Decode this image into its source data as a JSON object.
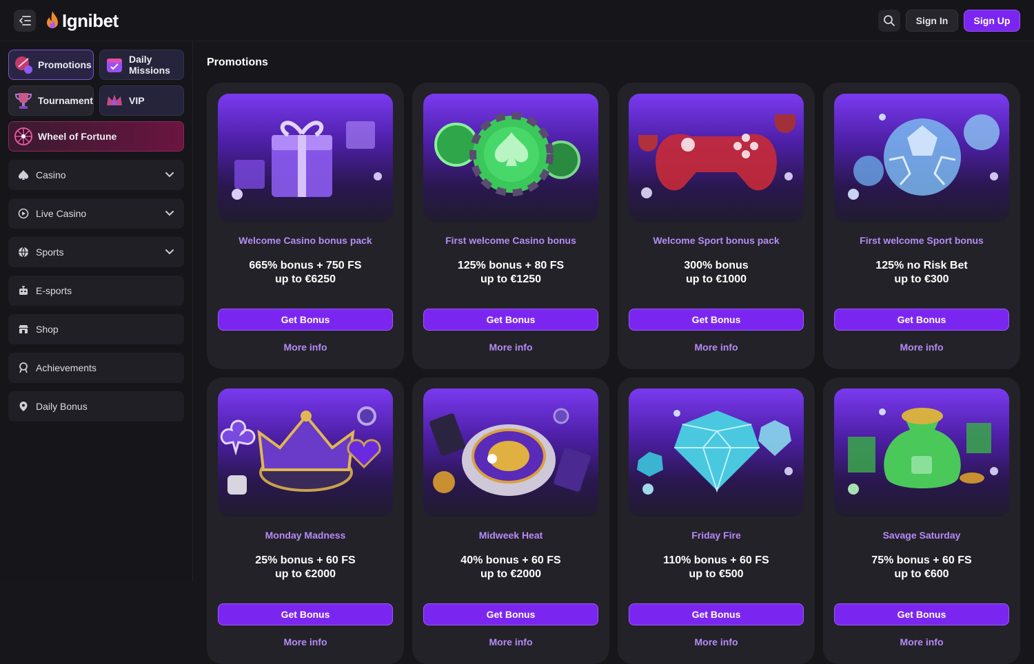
{
  "header": {
    "logo_text": "Ignibet",
    "sign_in": "Sign In",
    "sign_up": "Sign Up"
  },
  "sidebar": {
    "quick": {
      "promotions": "Promotions",
      "daily_line1": "Daily",
      "daily_line2": "Missions",
      "tournament": "Tournament",
      "vip": "VIP",
      "wheel": "Wheel of Fortune"
    },
    "nav": {
      "casino": "Casino",
      "live_casino": "Live Casino",
      "sports": "Sports",
      "esports": "E-sports",
      "shop": "Shop",
      "achievements": "Achievements",
      "daily_bonus": "Daily Bonus"
    }
  },
  "main": {
    "title": "Promotions",
    "get_bonus": "Get Bonus",
    "more_info": "More info",
    "cards": [
      {
        "title": "Welcome Casino bonus pack",
        "line1": "665% bonus + 750 FS",
        "line2": "up to €6250",
        "image": "gift-boxes"
      },
      {
        "title": "First welcome Casino bonus",
        "line1": "125% bonus + 80 FS",
        "line2": "up to €1250",
        "image": "casino-chips"
      },
      {
        "title": "Welcome Sport bonus pack",
        "line1": "300% bonus",
        "line2": "up to €1000",
        "image": "gamepad-trophies"
      },
      {
        "title": "First welcome Sport bonus",
        "line1": "125% no Risk Bet",
        "line2": "up to €300",
        "image": "crystal-balls"
      },
      {
        "title": "Monday Madness",
        "line1": "25% bonus + 60 FS",
        "line2": "up to €2000",
        "image": "crown"
      },
      {
        "title": "Midweek Heat",
        "line1": "40% bonus + 60 FS",
        "line2": "up to €2000",
        "image": "roulette"
      },
      {
        "title": "Friday Fire",
        "line1": "110% bonus + 60 FS",
        "line2": "up to €500",
        "image": "diamonds"
      },
      {
        "title": "Savage Saturday",
        "line1": "75% bonus + 60 FS",
        "line2": "up to €600",
        "image": "money-bags"
      }
    ]
  }
}
